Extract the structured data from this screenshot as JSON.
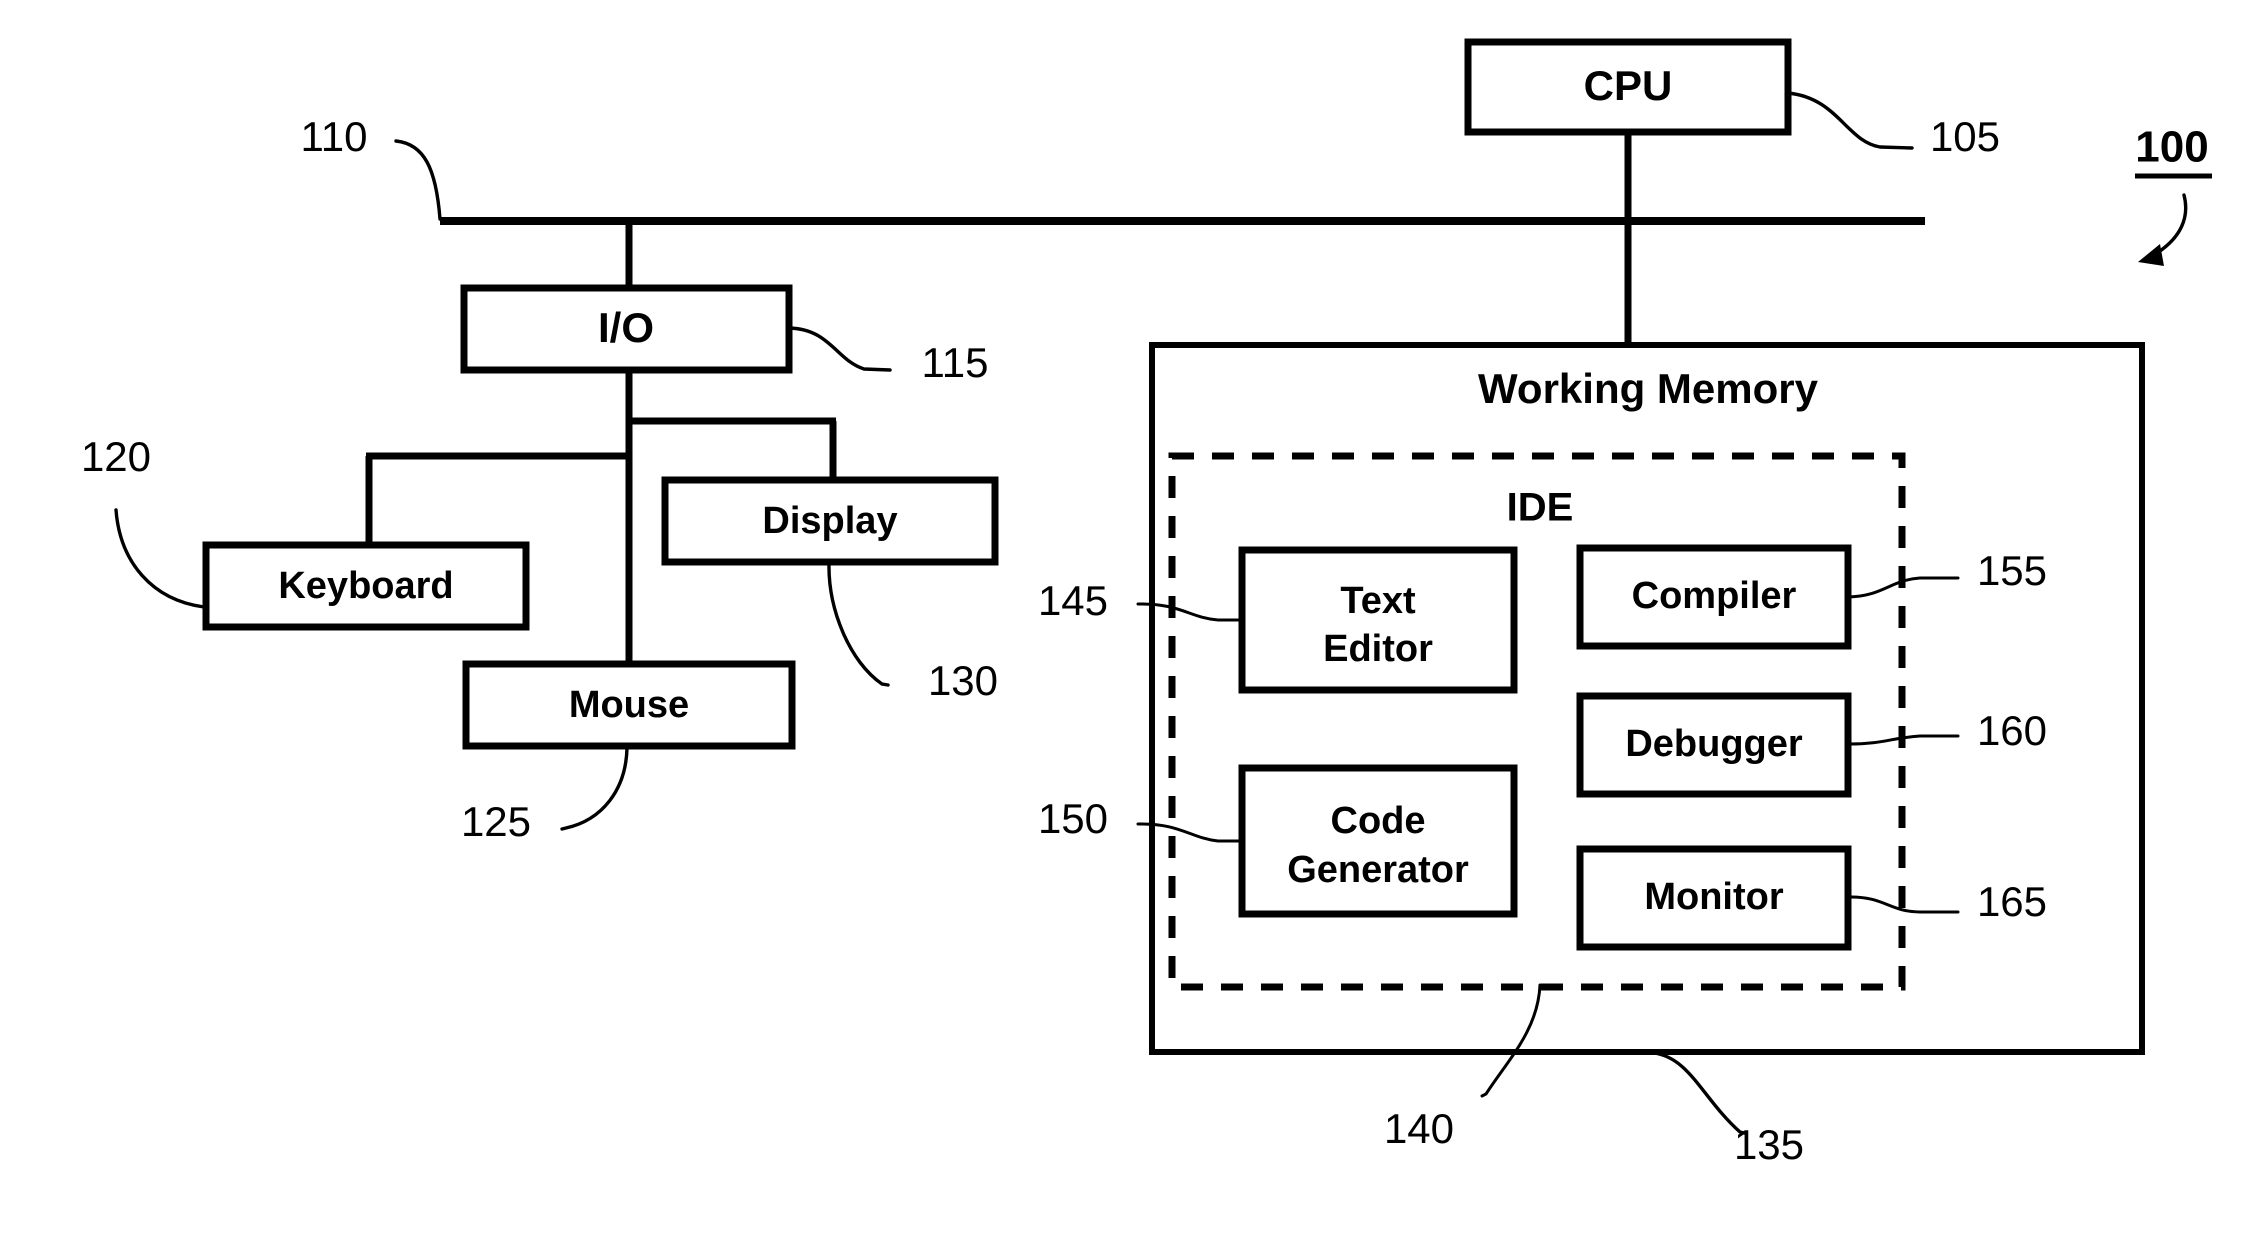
{
  "figure": {
    "figure_ref": "100",
    "background_color": "#ffffff",
    "line_color": "#000000"
  },
  "blocks": {
    "cpu": {
      "label": "CPU",
      "ref": "105"
    },
    "bus": {
      "ref": "110"
    },
    "io": {
      "label": "I/O",
      "ref": "115"
    },
    "keyboard": {
      "label": "Keyboard",
      "ref": "120"
    },
    "mouse": {
      "label": "Mouse",
      "ref": "125"
    },
    "display": {
      "label": "Display",
      "ref": "130"
    },
    "working_memory": {
      "label": "Working Memory",
      "ref": "135"
    },
    "ide": {
      "label": "IDE",
      "ref": "140"
    },
    "text_editor": {
      "label_line1": "Text",
      "label_line2": "Editor",
      "ref": "145"
    },
    "code_generator": {
      "label_line1": "Code",
      "label_line2": "Generator",
      "ref": "150"
    },
    "compiler": {
      "label": "Compiler",
      "ref": "155"
    },
    "debugger": {
      "label": "Debugger",
      "ref": "160"
    },
    "monitor": {
      "label": "Monitor",
      "ref": "165"
    }
  }
}
